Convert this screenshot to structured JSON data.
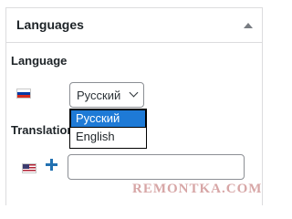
{
  "panel": {
    "title": "Languages",
    "toggle_icon": "triangle-up-icon"
  },
  "language": {
    "label": "Language",
    "flag": "flag-ru-icon",
    "selected": "Русский",
    "options": [
      "Русский",
      "English"
    ]
  },
  "translations": {
    "label": "Translations",
    "flag": "flag-us-icon",
    "add_icon": "plus-icon",
    "input_value": ""
  },
  "watermark": "REMONTKA.COM",
  "colors": {
    "accent": "#2271b1",
    "selected_option_bg": "#1e7ad6",
    "border": "#dcdcde",
    "watermark": "#d7a6a6"
  }
}
